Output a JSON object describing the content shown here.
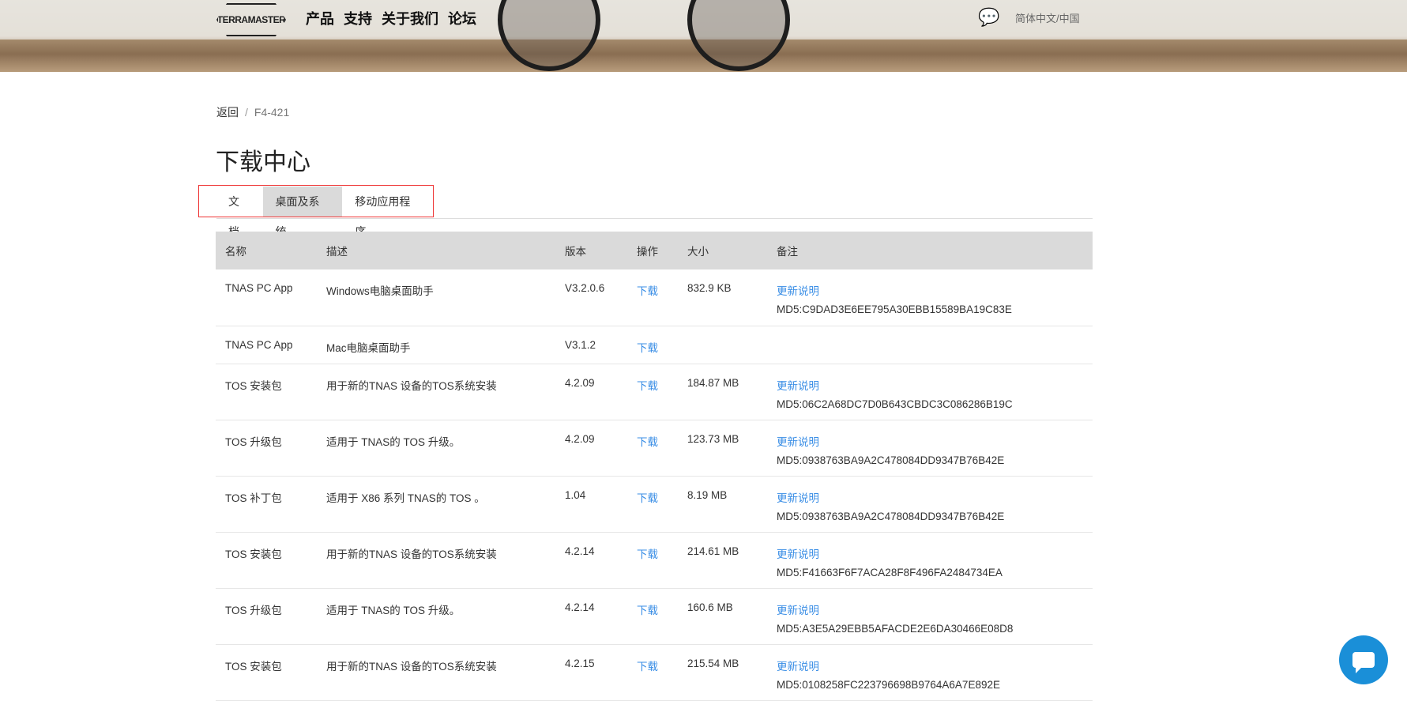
{
  "header": {
    "logo": "TERRAMASTER",
    "nav": [
      "产品",
      "支持",
      "关于我们",
      "论坛"
    ],
    "language": "简体中文/中国"
  },
  "breadcrumb": {
    "back": "返回",
    "sep": "/",
    "current": "F4-421"
  },
  "title": "下载中心",
  "tabs": [
    {
      "label": "文档",
      "active": false
    },
    {
      "label": "桌面及系统",
      "active": true
    },
    {
      "label": "移动应用程序",
      "active": false
    }
  ],
  "table": {
    "headers": [
      "名称",
      "描述",
      "版本",
      "操作",
      "大小",
      "备注"
    ],
    "rows": [
      {
        "name": "TNAS PC App",
        "desc": "Windows电脑桌面助手",
        "version": "V3.2.0.6",
        "action": "下载",
        "size": "832.9 KB",
        "note": "更新说明",
        "md5": "MD5:C9DAD3E6EE795A30EBB15589BA19C83E"
      },
      {
        "name": "TNAS PC App",
        "desc": "Mac电脑桌面助手",
        "version": "V3.1.2",
        "action": "下载",
        "size": "",
        "note": "",
        "md5": ""
      },
      {
        "name": "TOS 安装包",
        "desc": "用于新的TNAS 设备的TOS系统安装",
        "version": "4.2.09",
        "action": "下载",
        "size": "184.87 MB",
        "note": "更新说明",
        "md5": "MD5:06C2A68DC7D0B643CBDC3C086286B19C"
      },
      {
        "name": "TOS 升级包",
        "desc": "适用于 TNAS的 TOS 升级。",
        "version": "4.2.09",
        "action": "下载",
        "size": "123.73 MB",
        "note": "更新说明",
        "md5": "MD5:0938763BA9A2C478084DD9347B76B42E"
      },
      {
        "name": "TOS 补丁包",
        "desc": "适用于 X86 系列 TNAS的 TOS 。",
        "version": "1.04",
        "action": "下载",
        "size": "8.19 MB",
        "note": "更新说明",
        "md5": "MD5:0938763BA9A2C478084DD9347B76B42E"
      },
      {
        "name": "TOS 安装包",
        "desc": "用于新的TNAS 设备的TOS系统安装",
        "version": "4.2.14",
        "action": "下载",
        "size": "214.61 MB",
        "note": "更新说明",
        "md5": "MD5:F41663F6F7ACA28F8F496FA2484734EA"
      },
      {
        "name": "TOS 升级包",
        "desc": "适用于 TNAS的 TOS 升级。",
        "version": "4.2.14",
        "action": "下载",
        "size": "160.6 MB",
        "note": "更新说明",
        "md5": "MD5:A3E5A29EBB5AFACDE2E6DA30466E08D8"
      },
      {
        "name": "TOS 安装包",
        "desc": "用于新的TNAS 设备的TOS系统安装",
        "version": "4.2.15",
        "action": "下载",
        "size": "215.54 MB",
        "note": "更新说明",
        "md5": "MD5:0108258FC223796698B9764A6A7E892E"
      }
    ]
  }
}
